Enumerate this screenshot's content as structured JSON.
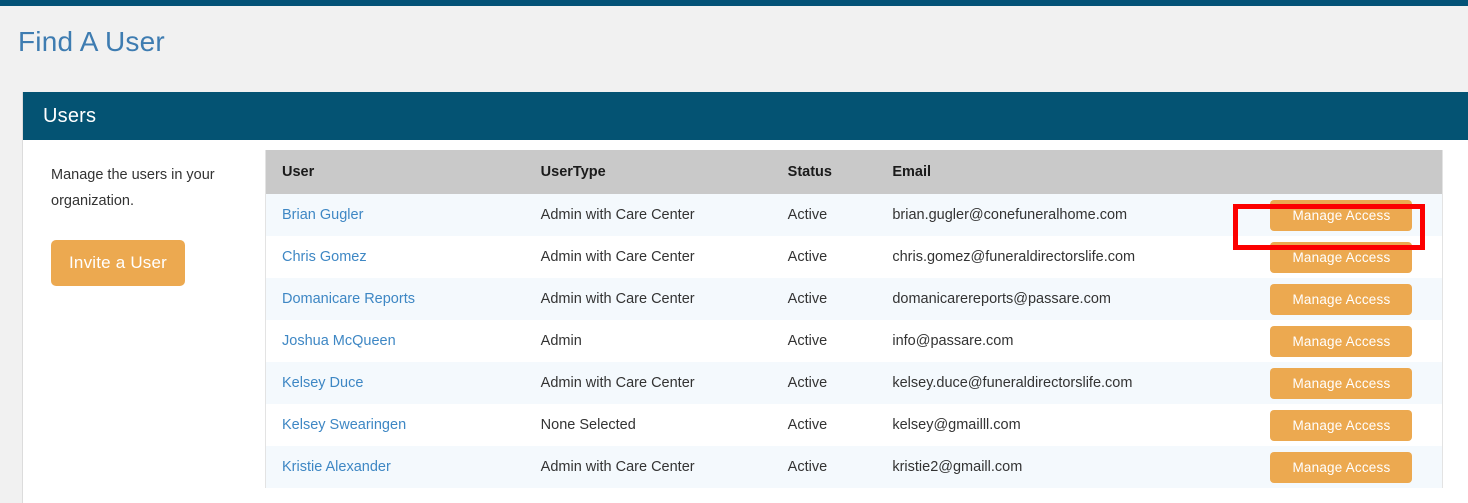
{
  "page": {
    "title": "Find A User",
    "accent_teal": "#045373",
    "accent_orange": "#eca950",
    "link_blue": "#3e87c4",
    "annotation_color": "#fc0000"
  },
  "card": {
    "header_title": "Users"
  },
  "side_panel": {
    "description": "Manage the users in your organization.",
    "invite_button": "Invite a User"
  },
  "table": {
    "columns": [
      "User",
      "UserType",
      "Status",
      "Email",
      ""
    ],
    "action_label": "Manage Access",
    "rows": [
      {
        "user": "Brian Gugler",
        "usertype": "Admin with Care Center",
        "status": "Active",
        "email": "brian.gugler@conefuneralhome.com",
        "action": "Manage Access"
      },
      {
        "user": "Chris Gomez",
        "usertype": "Admin with Care Center",
        "status": "Active",
        "email": "chris.gomez@funeraldirectorslife.com",
        "action": "Manage Access"
      },
      {
        "user": "Domanicare Reports",
        "usertype": "Admin with Care Center",
        "status": "Active",
        "email": "domanicarereports@passare.com",
        "action": "Manage Access"
      },
      {
        "user": "Joshua McQueen",
        "usertype": "Admin",
        "status": "Active",
        "email": "info@passare.com",
        "action": "Manage Access"
      },
      {
        "user": "Kelsey Duce",
        "usertype": "Admin with Care Center",
        "status": "Active",
        "email": "kelsey.duce@funeraldirectorslife.com",
        "action": "Manage Access"
      },
      {
        "user": "Kelsey Swearingen",
        "usertype": "None Selected",
        "status": "Active",
        "email": "kelsey@gmailll.com",
        "action": "Manage Access"
      },
      {
        "user": "Kristie Alexander",
        "usertype": "Admin with Care Center",
        "status": "Active",
        "email": "kristie2@gmaill.com",
        "action": "Manage Access"
      }
    ]
  }
}
